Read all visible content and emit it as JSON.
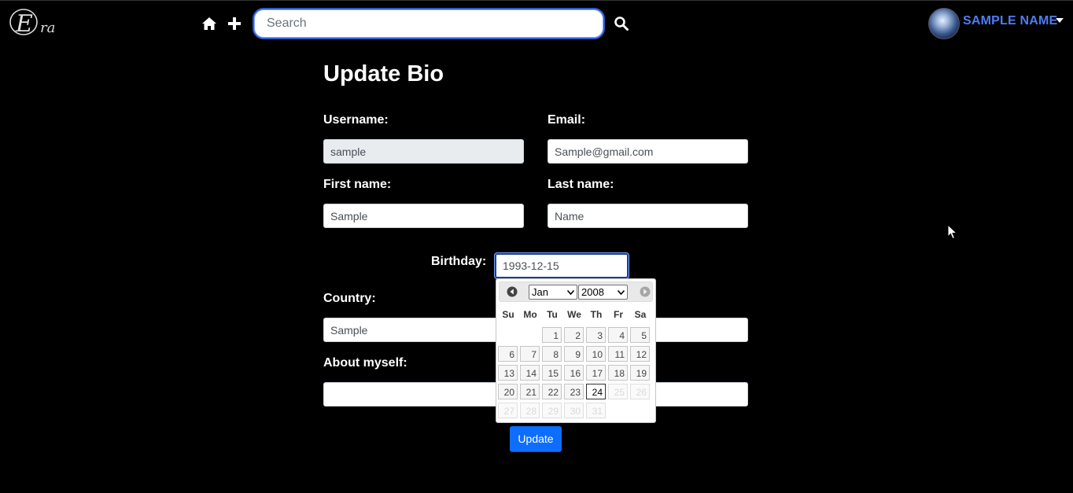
{
  "navbar": {
    "logo_text": "Era",
    "search_placeholder": "Search",
    "user_name": "SAMPLE NAME",
    "icons": [
      "home-icon",
      "plus-icon",
      "search-icon",
      "caret-down-icon"
    ]
  },
  "page": {
    "title": "Update Bio",
    "username_label": "Username:",
    "username_value": "sample",
    "email_label": "Email:",
    "email_value": "Sample@gmail.com",
    "first_name_label": "First name:",
    "first_name_value": "Sample",
    "last_name_label": "Last name:",
    "last_name_value": "Name",
    "birthday_label": "Birthday:",
    "birthday_value": "1993-12-15",
    "country_label": "Country:",
    "country_value": "Sample",
    "about_label": "About myself:",
    "about_value": "",
    "update_label": "Update"
  },
  "datepicker": {
    "month": "Jan",
    "year": "2008",
    "weekdays": [
      "Su",
      "Mo",
      "Tu",
      "We",
      "Th",
      "Fr",
      "Sa"
    ],
    "first_weekday_index": 2,
    "days_in_month": 31,
    "today": 24,
    "last_enabled_day": 24
  },
  "colors": {
    "background": "#000000",
    "user_name": "#4f7df2",
    "button": "#0d6efd",
    "search_border": "#2c5bd3"
  }
}
